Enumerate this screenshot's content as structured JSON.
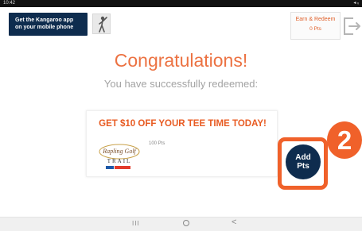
{
  "status_bar": {
    "time": "10:42",
    "right": "◂ ᵥ"
  },
  "header": {
    "promo_line1": "Get the Kangaroo app",
    "promo_line2": "on your mobile phone",
    "points_label": "Earn & Redeem",
    "points_value": "0 Pts"
  },
  "main": {
    "title": "Congratulations!",
    "subtitle": "You have successfully redeemed:"
  },
  "reward": {
    "title": "GET $10 OFF YOUR TEE TIME TODAY!",
    "points": "100 Pts",
    "logo_text": "Rapling Golf TRAIL"
  },
  "add_points": {
    "line1": "Add",
    "line2": "Pts"
  },
  "step_badge": "2",
  "nav": {
    "recents": "III",
    "back": "<"
  },
  "colors": {
    "accent": "#f0612a",
    "navy": "#0e2c4e",
    "title": "#ec7242"
  },
  "icons": [
    "golfer-icon",
    "logout-icon",
    "home-icon",
    "back-icon"
  ]
}
